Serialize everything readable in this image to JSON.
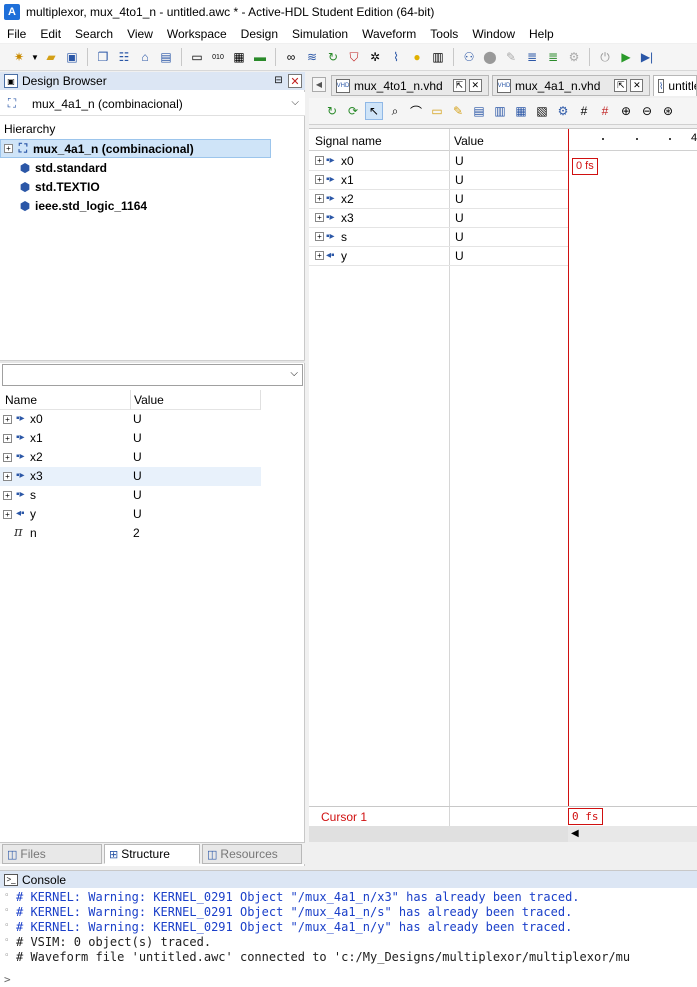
{
  "window": {
    "title": "multiplexor, mux_4to1_n - untitled.awc * - Active-HDL Student Edition (64-bit)",
    "logo_letter": "A"
  },
  "menu": [
    "File",
    "Edit",
    "Search",
    "View",
    "Workspace",
    "Design",
    "Simulation",
    "Waveform",
    "Tools",
    "Window",
    "Help"
  ],
  "design_browser": {
    "title": "Design Browser",
    "selected_design": "mux_4a1_n (combinacional)",
    "hierarchy_label": "Hierarchy",
    "tree": [
      {
        "label": "mux_4a1_n (combinacional)",
        "expandable": true,
        "selected": true
      },
      {
        "label": "std.standard"
      },
      {
        "label": "std.TEXTIO"
      },
      {
        "label": "ieee.std_logic_1164"
      }
    ],
    "objects": {
      "col_name": "Name",
      "col_value": "Value",
      "rows": [
        {
          "name": "x0",
          "value": "U"
        },
        {
          "name": "x1",
          "value": "U"
        },
        {
          "name": "x2",
          "value": "U"
        },
        {
          "name": "x3",
          "value": "U",
          "highlighted": true
        },
        {
          "name": "s",
          "value": "U"
        },
        {
          "name": "y",
          "value": "U"
        },
        {
          "name": "n",
          "value": "2",
          "generic": true
        }
      ]
    },
    "tabs": [
      "Files",
      "Structure",
      "Resources"
    ],
    "active_tab": "Structure"
  },
  "waveform": {
    "doc_tabs": [
      "mux_4to1_n.vhd",
      "mux_4a1_n.vhd",
      "untitled.awc"
    ],
    "col_signal": "Signal name",
    "col_value": "Value",
    "tick_label": "4",
    "signals": [
      {
        "name": "x0",
        "value": "U"
      },
      {
        "name": "x1",
        "value": "U"
      },
      {
        "name": "x2",
        "value": "U"
      },
      {
        "name": "x3",
        "value": "U"
      },
      {
        "name": "s",
        "value": "U"
      },
      {
        "name": "y",
        "value": "U"
      }
    ],
    "cursor_time": "0 fs",
    "cursor_label": "Cursor 1",
    "cursor_value": "0 fs"
  },
  "console": {
    "title": "Console",
    "lines": [
      {
        "text": "# KERNEL: Warning: KERNEL_0291 Object \"/mux_4a1_n/x3\" has already been traced.",
        "kind": "warn"
      },
      {
        "text": "# KERNEL: Warning: KERNEL_0291 Object \"/mux_4a1_n/s\" has already been traced.",
        "kind": "warn"
      },
      {
        "text": "# KERNEL: Warning: KERNEL_0291 Object \"/mux_4a1_n/y\" has already been traced.",
        "kind": "warn"
      },
      {
        "text": "# VSIM: 0 object(s) traced.",
        "kind": "info"
      },
      {
        "text": "# Waveform file 'untitled.awc' connected to 'c:/My_Designs/multiplexor/multiplexor/mu",
        "kind": "info"
      }
    ],
    "prompt": ">"
  },
  "colors": {
    "panel_header": "#dce6f4",
    "selection": "#cfe4f8",
    "cursor_red": "#d01010",
    "console_warning": "#1a3fc9",
    "icon_blue": "#2b57a7"
  }
}
